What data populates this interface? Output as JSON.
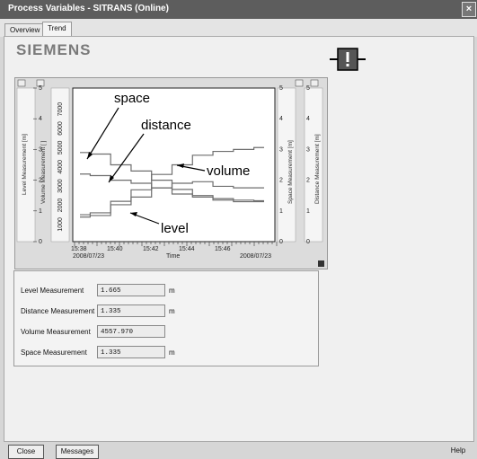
{
  "window": {
    "title": "Process Variables - SITRANS  (Online)",
    "close_glyph": "×"
  },
  "tabs": [
    {
      "label": "Overview"
    },
    {
      "label": "Trend"
    }
  ],
  "header": {
    "logo_text": "SIEMENS",
    "status_icon": "maintenance-exclamation-icon"
  },
  "chart": {
    "left_axis_title": "Level Measurement [m]",
    "left_axis_ticks": [
      "0",
      "1",
      "2",
      "3",
      "4",
      "5"
    ],
    "volume_axis_title": "Volume Measurement [ ]",
    "volume_axis_ticks": [
      "1000",
      "2000",
      "3000",
      "4000",
      "5000",
      "6000",
      "7000"
    ],
    "right_axis_title_1": "Space Measurement [m]",
    "right_axis_title_2": "Distance Measurement [m]",
    "right_axis_ticks": [
      "0",
      "1",
      "2",
      "3",
      "4",
      "5"
    ],
    "x_ticks": [
      "15:38",
      "15:40",
      "15:42",
      "15:44",
      "15:46"
    ],
    "x_start_date": "2008/07/23",
    "x_end_date": "2008/07/23",
    "x_axis_title": "Time",
    "annotations": {
      "space": "space",
      "distance": "distance",
      "volume": "volume",
      "level": "level"
    }
  },
  "measurements": [
    {
      "label": "Level Measurement",
      "value": "1.665",
      "unit": "m"
    },
    {
      "label": "Distance Measurement",
      "value": "1.335",
      "unit": "m"
    },
    {
      "label": "Volume Measurement",
      "value": "4557.970",
      "unit": ""
    },
    {
      "label": "Space Measurement",
      "value": "1.335",
      "unit": "m"
    }
  ],
  "buttons": {
    "close": "Close",
    "messages": "Messages",
    "help": "Help"
  },
  "colors": {
    "titlebar": "#5d5d5d",
    "plot_bg": "#ffffff",
    "trend_line": "#6e6e6e"
  },
  "chart_data": {
    "type": "line",
    "x": [
      "15:38",
      "15:39",
      "15:40",
      "15:41",
      "15:42",
      "15:43",
      "15:44",
      "15:45",
      "15:46",
      "15:47"
    ],
    "series": [
      {
        "name": "space",
        "values": [
          2.9,
          2.85,
          2.5,
          2.3,
          2.0,
          1.7,
          1.5,
          1.4,
          1.35,
          1.33
        ]
      },
      {
        "name": "distance",
        "values": [
          2.2,
          2.15,
          2.0,
          1.9,
          1.75,
          1.55,
          1.45,
          1.35,
          1.3,
          1.3
        ]
      },
      {
        "name": "volume",
        "values": [
          1400,
          1500,
          2100,
          2700,
          3500,
          4000,
          4500,
          4700,
          4800,
          4900
        ]
      },
      {
        "name": "level",
        "values": [
          0.8,
          0.85,
          1.2,
          1.45,
          1.75,
          1.9,
          1.95,
          1.8,
          1.75,
          1.75
        ]
      }
    ],
    "ylim": [
      0,
      5
    ],
    "volume_ylim": [
      0,
      8000
    ]
  }
}
